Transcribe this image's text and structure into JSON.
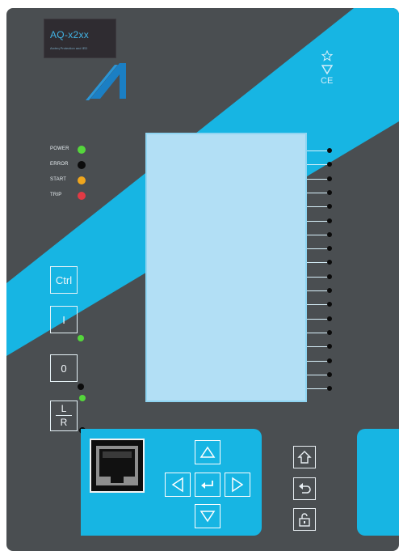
{
  "device": {
    "model": "AQ-x2xx",
    "model_subtitle": "Arcteq Protection and IED",
    "certifications": [
      "CE"
    ],
    "brand_color": "#17b5e3",
    "panel_color": "#4a4e51"
  },
  "leds": [
    {
      "label": "POWER",
      "color": "#55d63c"
    },
    {
      "label": "ERROR",
      "color": "#0c0c0c"
    },
    {
      "label": "START",
      "color": "#f0a61d"
    },
    {
      "label": "TRIP",
      "color": "#e23a44"
    }
  ],
  "keys": {
    "ctrl": "Ctrl",
    "on": "I",
    "off": "0",
    "local": "L",
    "remote": "R"
  },
  "display": {
    "indicator_count": 18,
    "background": "#b2dff5"
  },
  "navigation": {
    "up": "up-arrow-icon",
    "down": "down-arrow-icon",
    "left": "left-arrow-icon",
    "right": "right-arrow-icon",
    "enter": "enter-icon",
    "home": "home-icon",
    "back": "back-icon",
    "lock": "lock-icon"
  }
}
